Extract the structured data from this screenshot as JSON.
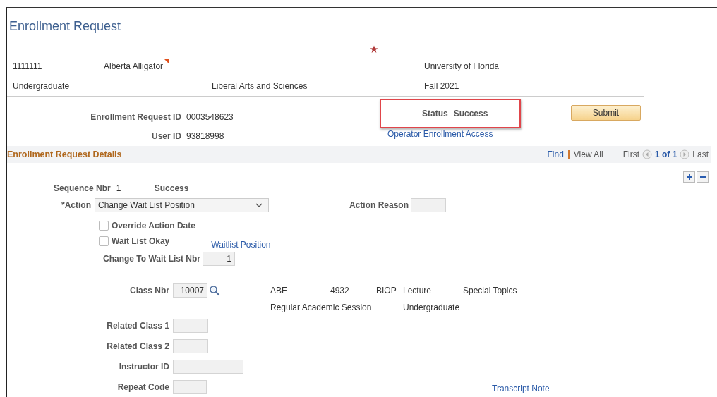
{
  "title": "Enrollment Request",
  "student": {
    "id": "1111111",
    "name": "Alberta Alligator",
    "institution": "University of Florida",
    "career": "Undergraduate",
    "program": "Liberal Arts and Sciences",
    "term": "Fall 2021"
  },
  "request": {
    "id_label": "Enrollment Request ID",
    "id": "0003548623",
    "user_label": "User ID",
    "user": "93818998",
    "status_label": "Status",
    "status": "Success",
    "highlighted": true,
    "submit": "Submit",
    "operator_link": "Operator Enrollment Access"
  },
  "details": {
    "title": "Enrollment Request Details",
    "find": "Find",
    "view_all": "View All",
    "first": "First",
    "count": "1 of 1",
    "last": "Last"
  },
  "sequence": {
    "label": "Sequence Nbr",
    "value": "1",
    "status": "Success",
    "action_label": "*Action",
    "action": "Change Wait List Position",
    "reason_label": "Action Reason",
    "checks": [
      {
        "label": "Override Action Date",
        "checked": false
      },
      {
        "label": "Wait List Okay",
        "checked": false
      }
    ],
    "waitlist_link": "Waitlist Position",
    "change_label": "Change To Wait List Nbr",
    "change_value": "1"
  },
  "class": {
    "label": "Class Nbr",
    "value": "10007",
    "info": [
      "ABE",
      "4932",
      "BIOP",
      "Lecture",
      "Special Topics"
    ],
    "info2": [
      "Regular Academic Session",
      "Undergraduate"
    ],
    "fields": [
      {
        "label": "Related Class 1"
      },
      {
        "label": "Related Class 2"
      },
      {
        "label": "Instructor ID"
      },
      {
        "label": "Repeat Code"
      }
    ],
    "transcript_link": "Transcript Note"
  }
}
